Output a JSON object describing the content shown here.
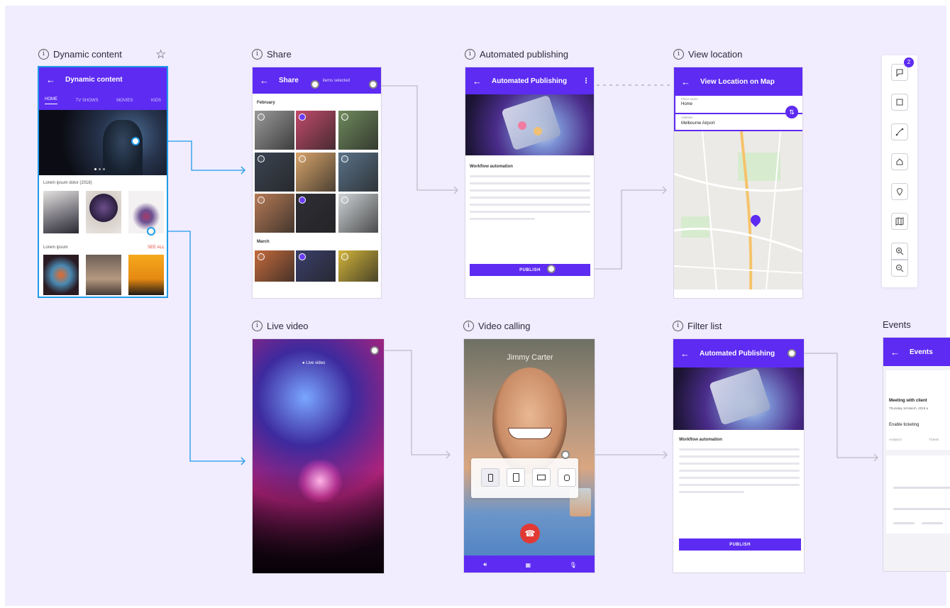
{
  "frames": {
    "dynamic": {
      "title": "Dynamic content",
      "appbar": "Dynamic content",
      "tabs": [
        "HOME",
        "TV SHOWS",
        "MOVIES",
        "KIDS"
      ],
      "section1": "Lorem ipsum dolor (2018)",
      "section2": "Lorem ipsum",
      "see_all": "SEE ALL"
    },
    "share": {
      "title": "Share",
      "appbar": "Share",
      "selected": "items selected",
      "month1": "February",
      "month2": "March"
    },
    "publishing": {
      "title": "Automated publishing",
      "appbar": "Automated Publishing",
      "heading": "Workflow automation",
      "button": "PUBLISH"
    },
    "location": {
      "title": "View location",
      "appbar": "View Location on Map",
      "field1_label": "Place name",
      "field1_value": "Home",
      "field2_label": "Address",
      "field2_value": "Melbourne Airport"
    },
    "live": {
      "title": "Live video",
      "label": "Live video"
    },
    "videocall": {
      "title": "Video calling",
      "caller": "Jimmy Carter"
    },
    "filter": {
      "title": "Filter list",
      "appbar": "Automated Publishing",
      "heading": "Workflow automation",
      "button": "PUBLISH"
    },
    "events": {
      "title": "Events",
      "appbar": "Events",
      "event_title": "Meeting with client",
      "event_date": "Thursday 18 March, 2019 a",
      "ticketing": "Enable ticketing",
      "col1": "Analytics",
      "col2": "Tickets"
    }
  },
  "toolbar": {
    "badge": "2",
    "items": [
      "comment-icon",
      "frame-icon",
      "connector-icon",
      "home-icon",
      "location-pin-icon",
      "map-icon",
      "zoom-in-icon",
      "zoom-out-icon"
    ]
  },
  "device_picker": [
    "phone-icon",
    "tablet-icon",
    "desktop-icon",
    "watch-icon"
  ],
  "colors": {
    "accent": "#5d2bf2",
    "selection": "#1e9be9",
    "canvas": "#f1ecfe"
  }
}
